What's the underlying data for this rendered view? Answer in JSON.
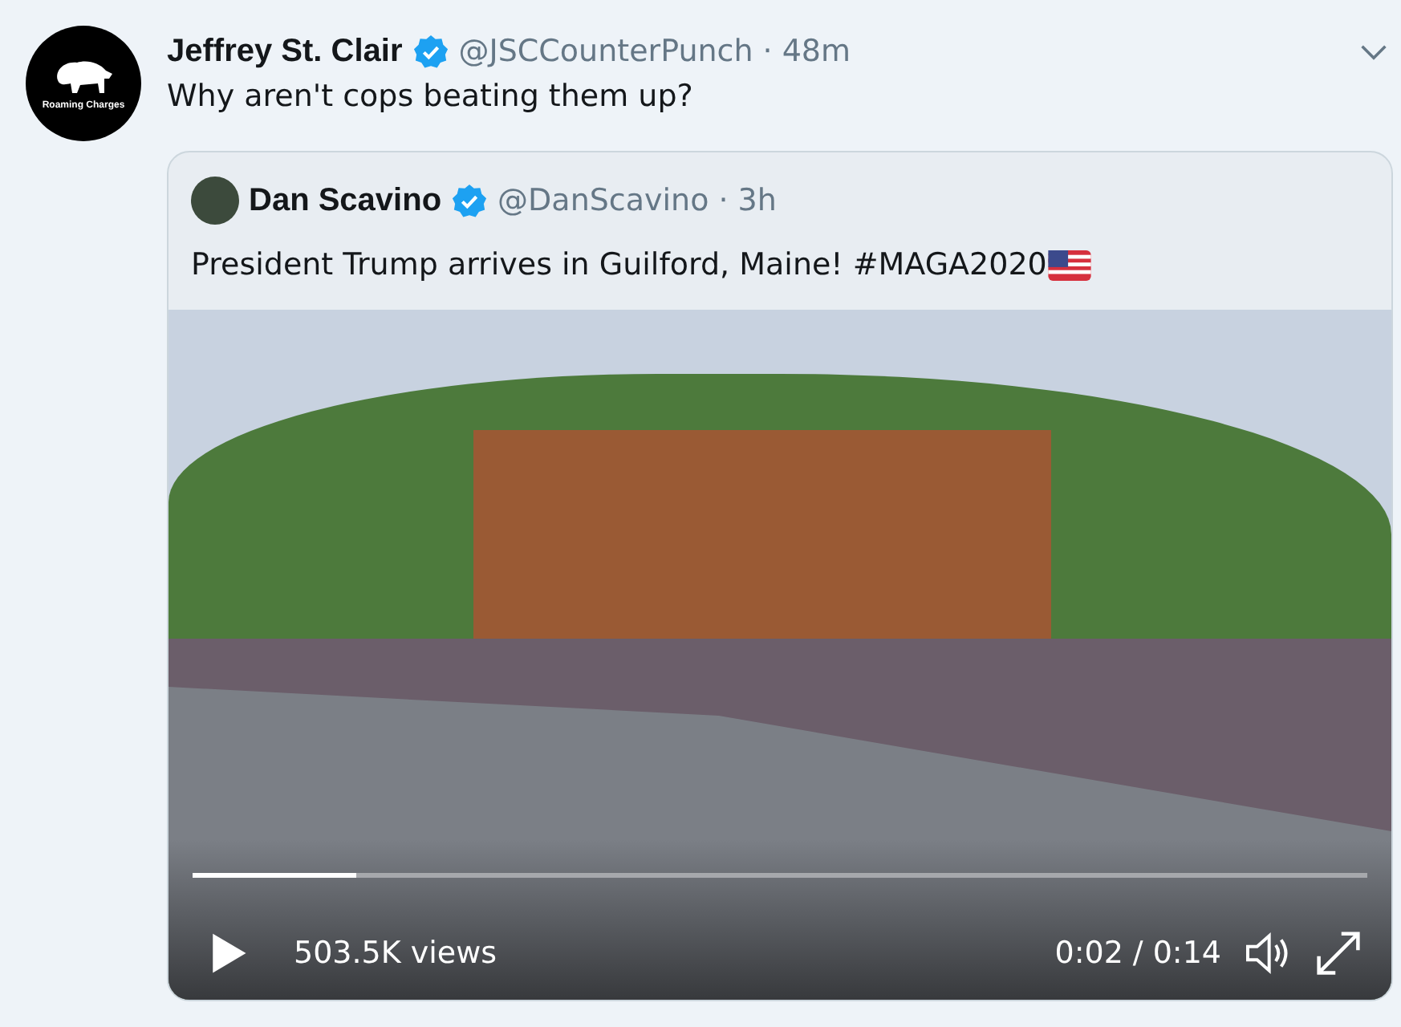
{
  "tweet": {
    "avatar_caption": "Roaming Charges",
    "name": "Jeffrey St. Clair",
    "verified": true,
    "handle": "@JSCCounterPunch",
    "separator": "·",
    "time": "48m",
    "text": "Why aren't cops beating them up?",
    "quoted": {
      "name": "Dan Scavino",
      "verified": true,
      "handle": "@DanScavino",
      "separator": "·",
      "time": "3h",
      "text": "President Trump arrives in Guilford, Maine! #MAGA2020",
      "video": {
        "level": 0.14,
        "views": "503.5K views",
        "elapsed": "0:02",
        "divider": "/",
        "duration": "0:14",
        "playing": false
      }
    }
  }
}
